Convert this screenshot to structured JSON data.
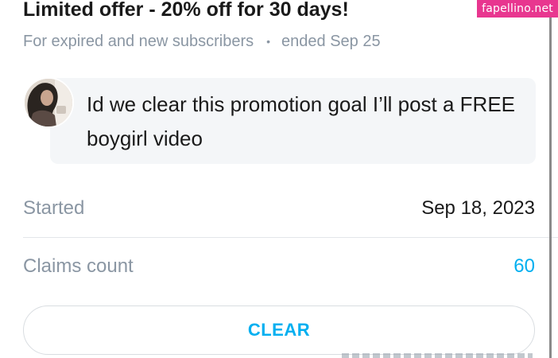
{
  "watermark": "fapellino.net",
  "promo": {
    "title": "Limited offer - 20% off for 30 days!",
    "audience": "For expired and new subscribers",
    "separator": "•",
    "ended": "ended Sep 25"
  },
  "message": {
    "text": "Id we clear this promotion goal I’ll post a FREE boygirl video"
  },
  "details": {
    "started_label": "Started",
    "started_value": "Sep 18, 2023",
    "claims_label": "Claims count",
    "claims_value": "60"
  },
  "actions": {
    "clear_label": "CLEAR"
  },
  "colors": {
    "accent": "#00aff0",
    "muted_text": "#8a96a3",
    "card_bg": "#f4f6f8",
    "watermark_bg": "#e8368f"
  },
  "icons": {
    "avatar": "user-avatar-photo"
  }
}
